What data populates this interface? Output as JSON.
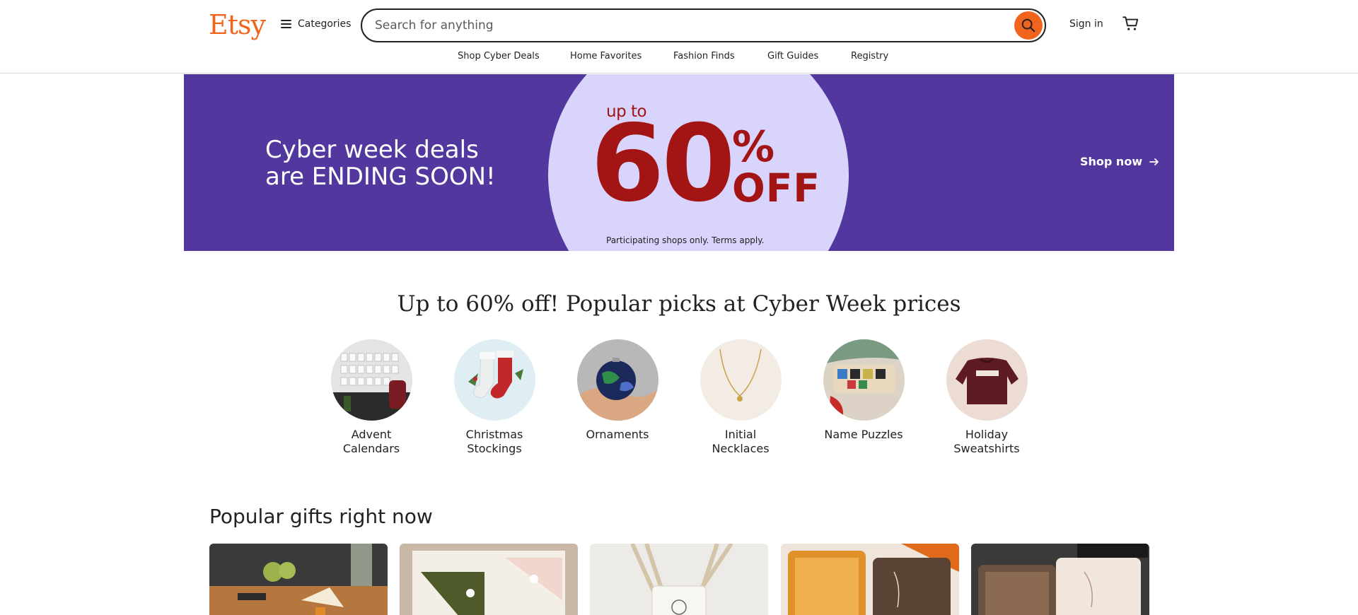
{
  "header": {
    "logo": "Etsy",
    "categories_label": "Categories",
    "search_placeholder": "Search for anything",
    "signin_label": "Sign in"
  },
  "subnav": [
    {
      "label": "Shop Cyber Deals"
    },
    {
      "label": "Home Favorites"
    },
    {
      "label": "Fashion Finds"
    },
    {
      "label": "Gift Guides"
    },
    {
      "label": "Registry"
    }
  ],
  "banner": {
    "headline_line1": "Cyber week deals",
    "headline_line2": "are ENDING SOON!",
    "up_to": "up to",
    "discount_number": "60",
    "percent_sign": "%",
    "off": "OFF",
    "terms": "Participating shops only. Terms apply.",
    "cta": "Shop now",
    "colors": {
      "background": "#51379e",
      "circle": "#d9d4fb",
      "discount_text": "#a31414"
    }
  },
  "section_title": "Up to 60% off! Popular picks at Cyber Week prices",
  "categories": [
    {
      "line1": "Advent",
      "line2": "Calendars",
      "icon": "advent-calendar-photo"
    },
    {
      "line1": "Christmas",
      "line2": "Stockings",
      "icon": "stockings-photo"
    },
    {
      "line1": "Ornaments",
      "line2": "",
      "icon": "ornament-photo"
    },
    {
      "line1": "Initial",
      "line2": "Necklaces",
      "icon": "necklace-photo"
    },
    {
      "line1": "Name Puzzles",
      "line2": "",
      "icon": "name-puzzle-photo"
    },
    {
      "line1": "Holiday",
      "line2": "Sweatshirts",
      "icon": "sweatshirt-photo"
    }
  ],
  "popular_gifts": {
    "title": "Popular gifts right now",
    "items": [
      {
        "icon": "cheese-board-photo"
      },
      {
        "icon": "bookmark-photo"
      },
      {
        "icon": "glass-cup-photo"
      },
      {
        "icon": "jewelry-box-photo"
      },
      {
        "icon": "jewelry-case-photo"
      }
    ]
  },
  "colors": {
    "accent": "#f1641e",
    "text": "#222222"
  }
}
